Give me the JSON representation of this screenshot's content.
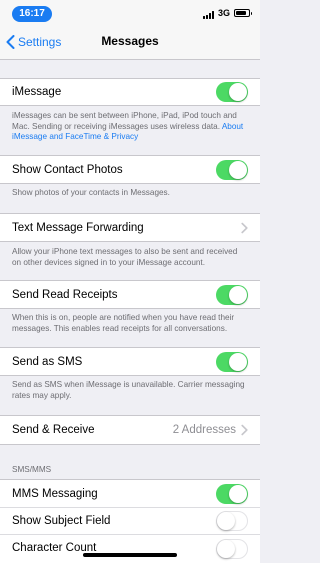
{
  "status_bar": {
    "time": "16:17",
    "network": "3G"
  },
  "nav": {
    "back_label": "Settings",
    "title": "Messages"
  },
  "imessage": {
    "label": "iMessage",
    "on": true,
    "footer": "iMessages can be sent between iPhone, iPad, iPod touch and Mac. Sending or receiving iMessages uses wireless data.",
    "footer_link": "About iMessage and FaceTime & Privacy"
  },
  "show_contact_photos": {
    "label": "Show Contact Photos",
    "on": true,
    "footer": "Show photos of your contacts in Messages."
  },
  "text_forwarding": {
    "label": "Text Message Forwarding",
    "footer": "Allow your iPhone text messages to also be sent and received on other devices signed in to your iMessage account."
  },
  "read_receipts": {
    "label": "Send Read Receipts",
    "on": true,
    "footer": "When this is on, people are notified when you have read their messages. This enables read receipts for all conversations."
  },
  "send_as_sms": {
    "label": "Send as SMS",
    "on": true,
    "footer": "Send as SMS when iMessage is unavailable. Carrier messaging rates may apply."
  },
  "send_receive": {
    "label": "Send & Receive",
    "detail": "2 Addresses"
  },
  "sms_mms": {
    "header": "SMS/MMS",
    "mms_messaging": {
      "label": "MMS Messaging",
      "on": true
    },
    "show_subject": {
      "label": "Show Subject Field",
      "on": false
    },
    "character_count": {
      "label": "Character Count",
      "on": false
    }
  },
  "colors": {
    "accent": "#1a7cf2",
    "toggle_on": "#4cd964",
    "background": "#efeff4"
  }
}
